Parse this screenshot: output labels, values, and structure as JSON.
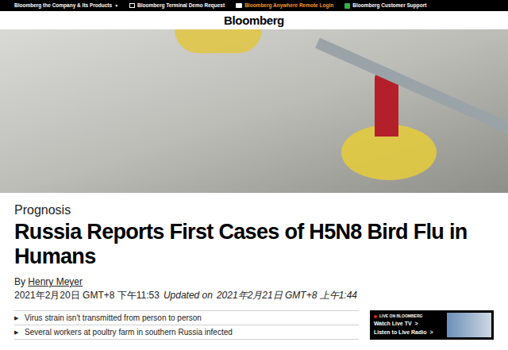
{
  "topbar": {
    "links": [
      {
        "label": "Bloomberg the Company & Its Products",
        "arrow": "▼",
        "icon": "none",
        "highlight": false
      },
      {
        "label": "Bloomberg Terminal Demo Request",
        "arrow": "",
        "icon": "terminal",
        "highlight": false
      },
      {
        "label": "Bloomberg Anywhere Remote Login",
        "arrow": "",
        "icon": "monitor",
        "highlight": true
      },
      {
        "label": "Bloomberg Customer Support",
        "arrow": "",
        "icon": "support",
        "highlight": false
      }
    ]
  },
  "header": {
    "logo": "Bloomberg"
  },
  "article": {
    "kicker": "Prognosis",
    "headline": "Russia Reports First Cases of H5N8 Bird Flu in Humans",
    "byline_prefix": "By ",
    "author": "Henry Meyer",
    "published": "2021年2月20日 GMT+8 下午11:53",
    "updated_label": "Updated on",
    "updated": "2021年2月21日 GMT+8 上午1:44",
    "bullets": [
      {
        "marker": "▶",
        "text": "Virus strain isn't transmitted from person to person"
      },
      {
        "marker": "▶",
        "text": "Several workers at poultry farm in southern Russia infected"
      }
    ]
  },
  "live": {
    "label": "LIVE ON BLOOMBERG",
    "links": [
      {
        "label": "Watch Live TV",
        "arrow": ">"
      },
      {
        "label": "Listen to Live Radio",
        "arrow": ">"
      }
    ]
  }
}
